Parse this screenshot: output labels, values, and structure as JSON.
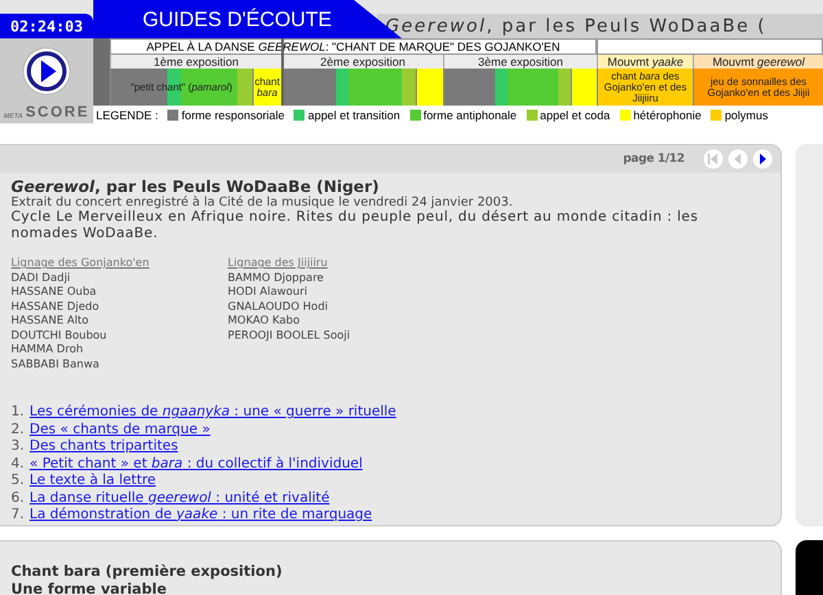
{
  "header": {
    "time": "02:24:03",
    "banner": "GUIDES D'ÉCOUTE",
    "title": "*Geerewol*, par les Peuls WoDaaBe (",
    "logo_small": "META",
    "logo_main": "SCORE"
  },
  "score": {
    "phrase": "APPEL À LA DANSE *GEEREWOL*: \"CHANT DE MARQUE\" DES GOJANKO'EN",
    "sections": [
      {
        "title": "1ème exposition",
        "kind": "exposition",
        "blocks": [
          {
            "label": "\"petit chant\" (*pamarol*)",
            "parts": [
              {
                "color": "#7a7a7a"
              },
              {
                "color": "#33cc66"
              },
              {
                "color": "#55cc33"
              },
              {
                "color": "#99cc33"
              }
            ]
          },
          {
            "label": "chant *bara*",
            "color": "#ffff00"
          }
        ]
      },
      {
        "title": "2ème exposition",
        "kind": "exposition",
        "blocks": [
          {
            "parts": [
              {
                "color": "#7a7a7a"
              },
              {
                "color": "#33cc66"
              },
              {
                "color": "#55cc33"
              },
              {
                "color": "#99cc33"
              }
            ]
          },
          {
            "color": "#ffff00"
          }
        ]
      },
      {
        "title": "3ème exposition",
        "kind": "exposition",
        "blocks": [
          {
            "parts": [
              {
                "color": "#7a7a7a"
              },
              {
                "color": "#33cc66"
              },
              {
                "color": "#55cc33"
              },
              {
                "color": "#99cc33"
              }
            ]
          },
          {
            "color": "#ffff00"
          }
        ]
      },
      {
        "title": "Mouvmt *yaake*",
        "kind": "mouvement",
        "blocks": [
          {
            "label": "chant *bara* des Gojanko'en et des Jiijiiru",
            "color": "#ffcc00"
          }
        ]
      },
      {
        "title": "Mouvmt *geerewol*",
        "kind": "mouvement",
        "blocks": [
          {
            "label": "jeu de sonnailles des Gojanko'en et des Jiijii",
            "color": "#ff9900"
          }
        ]
      }
    ],
    "legend_title": "LEGENDE :",
    "legend": [
      {
        "label": "forme responsoriale",
        "color": "#7a7a7a"
      },
      {
        "label": "appel et transition",
        "color": "#33cc66"
      },
      {
        "label": "forme antiphonale",
        "color": "#55cc33"
      },
      {
        "label": "appel et coda",
        "color": "#99cc33"
      },
      {
        "label": "hétérophonie",
        "color": "#ffff00"
      },
      {
        "label": "polymus",
        "color": "#ffcc00"
      }
    ]
  },
  "panel": {
    "page": "page 1/12",
    "nav": [
      {
        "kind": "first",
        "disabled": true
      },
      {
        "kind": "prev",
        "disabled": true
      },
      {
        "kind": "next",
        "disabled": false
      }
    ],
    "title": "*Geerewol*, par les Peuls WoDaaBe (Niger)",
    "note": "Extrait du concert enregistré à la Cité de la musique le vendredi 24 janvier 2003.",
    "cycle": "Cycle Le Merveilleux en Afrique noire. Rites du peuple peul, du désert au monde citadin : les nomades WoDaaBe.",
    "lineages": [
      {
        "heading": "Lignage des Gonjanko'en",
        "members": [
          "DADI Dadji",
          "HASSANE Ouba",
          "HASSANE Djedo",
          "HASSANE Alto",
          "DOUTCHI Boubou",
          "HAMMA Droh",
          "SABBABI Banwa"
        ]
      },
      {
        "heading": "Lignage des Jiijiiru",
        "members": [
          "BAMMO Djoppare",
          "HODI Alawouri",
          "GNALAOUDO Hodi",
          "MOKAO Kabo",
          "PEROOJI BOOLEL Sooji"
        ]
      }
    ],
    "chapters": [
      {
        "number": "1.",
        "title": "Les cérémonies de *ngaanyka* : une « guerre » rituelle"
      },
      {
        "number": "2.",
        "title": "Des « chants de marque »"
      },
      {
        "number": "3.",
        "title": "Des chants tripartites"
      },
      {
        "number": "4.",
        "title": "« Petit chant » et *bara* : du collectif à l'individuel"
      },
      {
        "number": "5.",
        "title": "Le texte à la lettre"
      },
      {
        "number": "6.",
        "title": "La danse rituelle *geerewol* : unité et rivalité"
      },
      {
        "number": "7.",
        "title": "La démonstration de *yaake* : un rite de marquage"
      }
    ]
  },
  "section": {
    "title": "Chant bara (première exposition)",
    "subtitle": "Une forme variable"
  }
}
